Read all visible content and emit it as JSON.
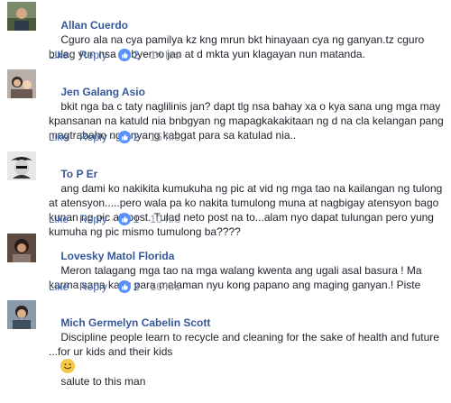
{
  "comments": [
    {
      "author": "Allan Cuerdo",
      "text": "Cguro ala na cya pamilya kz kng mrun bkt hinayaan cya ng ganyan.tz cguro bulag yun nsa gubyerno jan at d mkta yun klagayan nun matanda.",
      "like_label": "Like",
      "reply_label": "Reply",
      "reactions": "2",
      "time": "14 hrs",
      "reaction_icon": "thumbs-up-icon"
    },
    {
      "author": "Jen Galang Asio",
      "text": "bkit nga ba c taty naglilinis jan? dapt tlg nsa bahay xa o kya sana ung mga may kpansanan na katuld nia bnbgyan ng mapagkakakitaan ng d na cla kelangan pang magtrabaho ng gnyang kabgat para sa katulad nia..",
      "like_label": "Like",
      "reply_label": "Reply",
      "reactions": "2",
      "time": "15 hrs",
      "reaction_icon": "thumbs-up-icon"
    },
    {
      "author": "To P Er",
      "text": "ang dami ko nakikita kumukuha ng pic at vid ng mga tao na kailangan ng tulong at atensyon.....pero wala pa ko nakita tumulong muna at nagbigay atensyon bago kunan ng pic at ipost. Tulad neto post na to...alam nyo dapat tulungan pero yung kumuha ng pic mismo tumulong ba????",
      "like_label": "Like",
      "reply_label": "Reply",
      "reactions": "1",
      "time": "10 hrs",
      "reaction_icon": "thumbs-up-icon"
    },
    {
      "author": "Lovesky Matol Florida",
      "text": "Meron talagang mga tao na mga walang kwenta ang ugali asal basura ! Ma karma sana kayu para malaman nyu kong papano ang maging ganyan.! Piste",
      "like_label": "Like",
      "reply_label": "Reply",
      "reactions": "2",
      "time": "16 hrs",
      "reaction_icon": "thumbs-up-icon"
    },
    {
      "author": "Mich Germelyn Cabelin Scott",
      "text_before": "Discipline people learn to recycle and cleaning for the sake of health and future ...for ur kids and their kids",
      "text_after": "salute to this man",
      "emoji_icon": "smiley-icon"
    }
  ],
  "colors": {
    "author": "#365899",
    "link": "#4267b2",
    "meta": "#90949c",
    "reaction": "#5890ff",
    "text": "#1d2129"
  }
}
